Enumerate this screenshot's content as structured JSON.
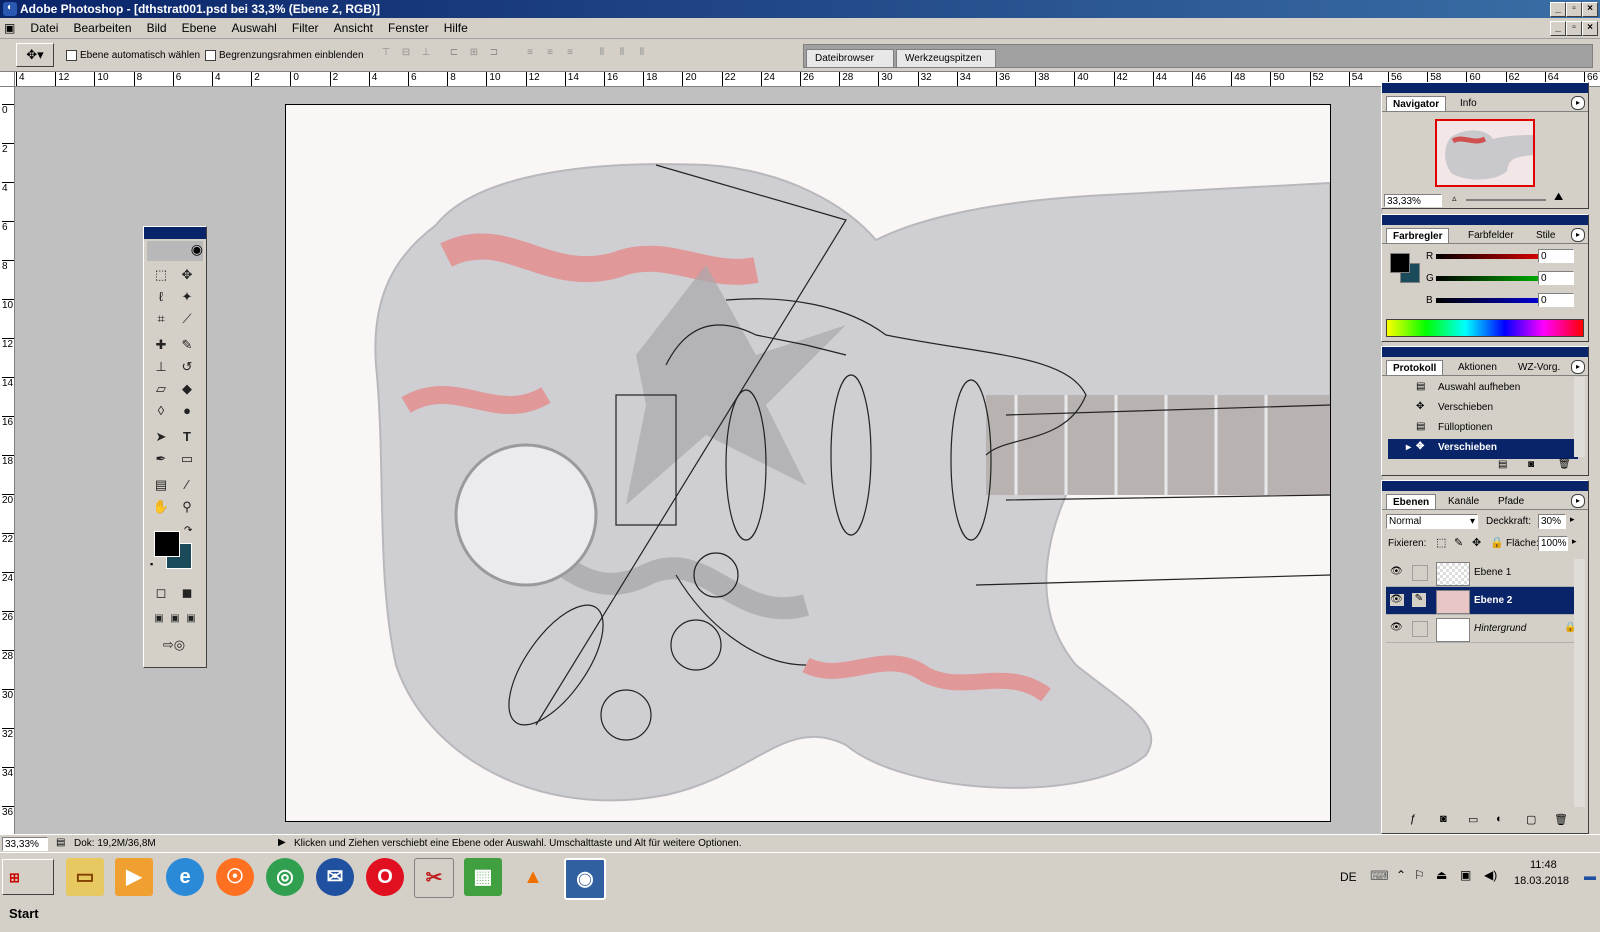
{
  "window": {
    "title": "Adobe Photoshop - [dthstrat001.psd bei 33,3% (Ebene 2, RGB)]"
  },
  "menu": [
    "Datei",
    "Bearbeiten",
    "Bild",
    "Ebene",
    "Auswahl",
    "Filter",
    "Ansicht",
    "Fenster",
    "Hilfe"
  ],
  "options": {
    "auto_select_label": "Ebene automatisch wählen",
    "bounding_box_label": "Begrenzungsrahmen einblenden",
    "well_tabs": [
      "Dateibrowser",
      "Werkzeugspitzen"
    ]
  },
  "ruler": {
    "top": [
      "4",
      "12",
      "10",
      "8",
      "6",
      "4",
      "2",
      "0",
      "2",
      "4",
      "6",
      "8",
      "10",
      "12",
      "14",
      "16",
      "18",
      "20",
      "22",
      "24",
      "26",
      "28",
      "30",
      "32",
      "34",
      "36",
      "38",
      "40",
      "42",
      "44",
      "46",
      "48",
      "50",
      "52",
      "54",
      "56",
      "58",
      "60",
      "62",
      "64",
      "66"
    ],
    "left": [
      "0",
      "2",
      "4",
      "6",
      "8",
      "10",
      "12",
      "14",
      "16",
      "18",
      "20",
      "22",
      "24",
      "26",
      "28",
      "30",
      "32",
      "34",
      "36"
    ]
  },
  "navigator": {
    "tabs": [
      "Navigator",
      "Info"
    ],
    "zoom": "33,33%"
  },
  "color": {
    "tabs": [
      "Farbregler",
      "Farbfelder",
      "Stile"
    ],
    "channels": [
      {
        "label": "R",
        "value": "0"
      },
      {
        "label": "G",
        "value": "0"
      },
      {
        "label": "B",
        "value": "0"
      }
    ],
    "foreground": "#000000",
    "background": "#1b4a5a"
  },
  "history": {
    "tabs": [
      "Protokoll",
      "Aktionen",
      "WZ-Vorg."
    ],
    "items": [
      "Auswahl aufheben",
      "Verschieben",
      "Fülloptionen",
      "Verschieben"
    ],
    "active_index": 3
  },
  "layers": {
    "tabs": [
      "Ebenen",
      "Kanäle",
      "Pfade"
    ],
    "blend_mode": "Normal",
    "opacity_label": "Deckkraft:",
    "opacity": "30%",
    "lock_label": "Fixieren:",
    "fill_label": "Fläche:",
    "fill": "100%",
    "items": [
      {
        "name": "Ebene 1",
        "active": false
      },
      {
        "name": "Ebene 2",
        "active": true
      },
      {
        "name": "Hintergrund",
        "active": false
      }
    ]
  },
  "status": {
    "zoom": "33,33%",
    "doc": "Dok: 19,2M/36,8M",
    "hint": "Klicken und Ziehen verschiebt eine Ebene oder Auswahl. Umschalttaste und Alt für weitere Optionen."
  },
  "taskbar": {
    "start": "Start",
    "lang": "DE",
    "time": "11:48",
    "date": "18.03.2018"
  }
}
